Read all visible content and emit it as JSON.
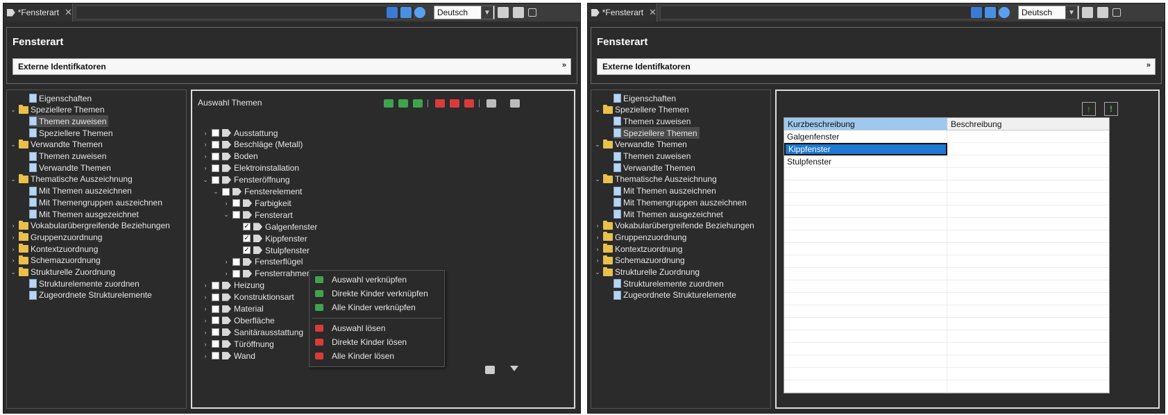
{
  "left": {
    "tab": {
      "label": "*Fensterart",
      "close": "✕"
    },
    "language": "Deutsch",
    "header": {
      "title": "Fensterart",
      "ext_label": "Externe Identifkatoren",
      "ext_chevron": "»"
    },
    "nav": [
      {
        "label": "Eigenschaften",
        "level": 1,
        "kind": "page"
      },
      {
        "label": "Speziellere Themen",
        "level": 0,
        "kind": "folder",
        "expanded": true
      },
      {
        "label": "Themen zuweisen",
        "level": 1,
        "kind": "page",
        "selected": true
      },
      {
        "label": "Speziellere Themen",
        "level": 1,
        "kind": "page"
      },
      {
        "label": "Verwandte Themen",
        "level": 0,
        "kind": "folder",
        "expanded": true
      },
      {
        "label": "Themen zuweisen",
        "level": 1,
        "kind": "page"
      },
      {
        "label": "Verwandte Themen",
        "level": 1,
        "kind": "page"
      },
      {
        "label": "Thematische Auszeichnung",
        "level": 0,
        "kind": "folder",
        "expanded": true
      },
      {
        "label": "Mit Themen auszeichnen",
        "level": 1,
        "kind": "page"
      },
      {
        "label": "Mit Themengruppen auszeichnen",
        "level": 1,
        "kind": "page"
      },
      {
        "label": "Mit Themen ausgezeichnet",
        "level": 1,
        "kind": "page"
      },
      {
        "label": "Vokabularübergreifende Beziehungen",
        "level": 0,
        "kind": "folder",
        "expanded": false
      },
      {
        "label": "Gruppenzuordnung",
        "level": 0,
        "kind": "folder",
        "expanded": false
      },
      {
        "label": "Kontextzuordnung",
        "level": 0,
        "kind": "folder",
        "expanded": false
      },
      {
        "label": "Schemazuordnung",
        "level": 0,
        "kind": "folder",
        "expanded": false
      },
      {
        "label": "Strukturelle Zuordnung",
        "level": 0,
        "kind": "folder",
        "expanded": true
      },
      {
        "label": "Strukturelemente zuordnen",
        "level": 1,
        "kind": "page"
      },
      {
        "label": "Zugeordnete Strukturelemente",
        "level": 1,
        "kind": "page"
      }
    ],
    "themes": {
      "title": "Auswahl Themen",
      "separator": "|",
      "tree": [
        {
          "label": "Ausstattung",
          "level": 0,
          "twisty": "›",
          "checked": false
        },
        {
          "label": "Beschläge (Metall)",
          "level": 0,
          "twisty": "›",
          "checked": false
        },
        {
          "label": "Boden",
          "level": 0,
          "twisty": "›",
          "checked": false
        },
        {
          "label": "Elektroinstallation",
          "level": 0,
          "twisty": "›",
          "checked": false
        },
        {
          "label": "Fensteröffnung",
          "level": 0,
          "twisty": "⌄",
          "checked": false
        },
        {
          "label": "Fensterelement",
          "level": 1,
          "twisty": "⌄",
          "checked": false
        },
        {
          "label": "Farbigkeit",
          "level": 2,
          "twisty": "›",
          "checked": false
        },
        {
          "label": "Fensterart",
          "level": 2,
          "twisty": "⌄",
          "checked": false
        },
        {
          "label": "Galgenfenster",
          "level": 3,
          "twisty": "",
          "checked": true
        },
        {
          "label": "Kippfenster",
          "level": 3,
          "twisty": "",
          "checked": true
        },
        {
          "label": "Stulpfenster",
          "level": 3,
          "twisty": "",
          "checked": true
        },
        {
          "label": "Fensterflügel",
          "level": 2,
          "twisty": "›",
          "checked": false
        },
        {
          "label": "Fensterrahmen",
          "level": 2,
          "twisty": "›",
          "checked": false
        },
        {
          "label": "Heizung",
          "level": 0,
          "twisty": "›",
          "checked": false
        },
        {
          "label": "Konstruktionsart",
          "level": 0,
          "twisty": "›",
          "checked": false
        },
        {
          "label": "Material",
          "level": 0,
          "twisty": "›",
          "checked": false
        },
        {
          "label": "Oberfläche",
          "level": 0,
          "twisty": "›",
          "checked": false
        },
        {
          "label": "Sanitärausstattung",
          "level": 0,
          "twisty": "›",
          "checked": false
        },
        {
          "label": "Türöffnung",
          "level": 0,
          "twisty": "›",
          "checked": false
        },
        {
          "label": "Wand",
          "level": 0,
          "twisty": "›",
          "checked": false
        }
      ],
      "context_menu": [
        {
          "label": "Auswahl verknüpfen",
          "color": "#3fa34d"
        },
        {
          "label": "Direkte Kinder verknüpfen",
          "color": "#3fa34d"
        },
        {
          "label": "Alle Kinder verknüpfen",
          "color": "#3fa34d"
        },
        {
          "label": "Auswahl lösen",
          "color": "#d93b3b"
        },
        {
          "label": "Direkte Kinder lösen",
          "color": "#d93b3b"
        },
        {
          "label": "Alle Kinder lösen",
          "color": "#d93b3b"
        }
      ]
    }
  },
  "right": {
    "tab": {
      "label": "*Fensterart",
      "close": "✕"
    },
    "language": "Deutsch",
    "header": {
      "title": "Fensterart",
      "ext_label": "Externe Identifkatoren",
      "ext_chevron": "»"
    },
    "nav": [
      {
        "label": "Eigenschaften",
        "level": 1,
        "kind": "page"
      },
      {
        "label": "Speziellere Themen",
        "level": 0,
        "kind": "folder",
        "expanded": true
      },
      {
        "label": "Themen zuweisen",
        "level": 1,
        "kind": "page"
      },
      {
        "label": "Speziellere Themen",
        "level": 1,
        "kind": "page",
        "selected": true
      },
      {
        "label": "Verwandte Themen",
        "level": 0,
        "kind": "folder",
        "expanded": true
      },
      {
        "label": "Themen zuweisen",
        "level": 1,
        "kind": "page"
      },
      {
        "label": "Verwandte Themen",
        "level": 1,
        "kind": "page"
      },
      {
        "label": "Thematische Auszeichnung",
        "level": 0,
        "kind": "folder",
        "expanded": true
      },
      {
        "label": "Mit Themen auszeichnen",
        "level": 1,
        "kind": "page"
      },
      {
        "label": "Mit Themengruppen auszeichnen",
        "level": 1,
        "kind": "page"
      },
      {
        "label": "Mit Themen ausgezeichnet",
        "level": 1,
        "kind": "page"
      },
      {
        "label": "Vokabularübergreifende Beziehungen",
        "level": 0,
        "kind": "folder",
        "expanded": false
      },
      {
        "label": "Gruppenzuordnung",
        "level": 0,
        "kind": "folder",
        "expanded": false
      },
      {
        "label": "Kontextzuordnung",
        "level": 0,
        "kind": "folder",
        "expanded": false
      },
      {
        "label": "Schemazuordnung",
        "level": 0,
        "kind": "folder",
        "expanded": false
      },
      {
        "label": "Strukturelle Zuordnung",
        "level": 0,
        "kind": "folder",
        "expanded": true
      },
      {
        "label": "Strukturelemente zuordnen",
        "level": 1,
        "kind": "page"
      },
      {
        "label": "Zugeordnete Strukturelemente",
        "level": 1,
        "kind": "page"
      }
    ],
    "table": {
      "buttons": [
        "↑",
        "!"
      ],
      "columns": [
        "Kurzbeschreibung",
        "Beschreibung"
      ],
      "rows": [
        {
          "kurz": "Galgenfenster",
          "beschreibung": "",
          "selected": false
        },
        {
          "kurz": "Kippfenster",
          "beschreibung": "",
          "selected": true
        },
        {
          "kurz": "Stulpfenster",
          "beschreibung": "",
          "selected": false
        }
      ]
    }
  }
}
